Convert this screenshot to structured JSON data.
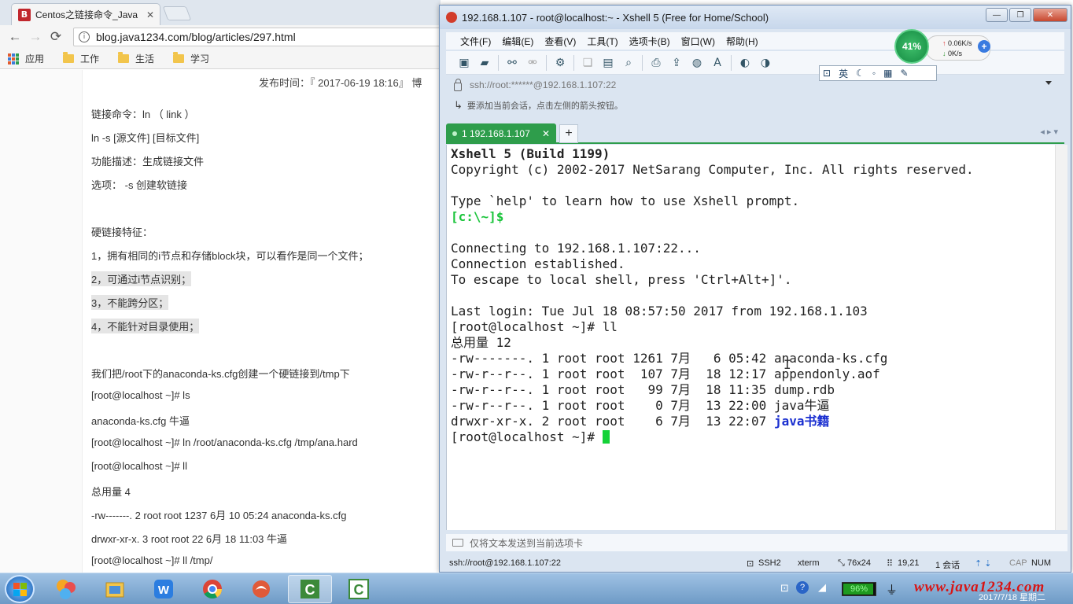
{
  "browser": {
    "tab_title": "Centos之链接命令_Java",
    "favicon_letter": "B",
    "url": "blog.java1234.com/blog/articles/297.html",
    "bookmarks": [
      "应用",
      "工作",
      "生活",
      "学习"
    ]
  },
  "article": {
    "publish_time": "发布时间：『 2017-06-19 18:16』  博",
    "lines": [
      "链接命令：ln （ link ）",
      "ln -s [源文件] [目标文件]",
      "功能描述：生成链接文件",
      "选项： -s 创建软链接",
      "硬链接特征：",
      "1，拥有相同的i节点和存储block块，可以看作是同一个文件；",
      "2，可通过i节点识别；",
      "3，不能跨分区；",
      "4，不能针对目录使用；",
      "我们把/root下的anaconda-ks.cfg创建一个硬链接到/tmp下",
      "[root@localhost ~]# ls",
      "anaconda-ks.cfg  牛逼",
      "[root@localhost ~]# ln /root/anaconda-ks.cfg /tmp/ana.hard",
      "[root@localhost ~]# ll",
      "总用量 4",
      "-rw-------. 2 root root 1237 6月  10 05:24 anaconda-ks.cfg",
      "drwxr-xr-x. 3 root root   22 6月  18 11:03 牛逼",
      "[root@localhost ~]# ll /tmp/"
    ]
  },
  "xshell": {
    "title": "192.168.1.107 - root@localhost:~ - Xshell 5 (Free for Home/School)",
    "menu": [
      "文件(F)",
      "编辑(E)",
      "查看(V)",
      "工具(T)",
      "选项卡(B)",
      "窗口(W)",
      "帮助(H)"
    ],
    "address": "ssh://root:******@192.168.1.107:22",
    "hint": "要添加当前会话，点击左侧的箭头按钮。",
    "tab_label": "1 192.168.1.107",
    "ime": [
      "英"
    ],
    "net": {
      "cpu": "41%",
      "up": "0.06K/s",
      "down": "0K/s"
    },
    "terminal": {
      "banner1": "Xshell 5 (Build 1199)",
      "banner2": "Copyright (c) 2002-2017 NetSarang Computer, Inc. All rights reserved.",
      "help": "Type `help' to learn how to use Xshell prompt.",
      "local_prompt": "[c:\\~]$",
      "connecting": "Connecting to 192.168.1.107:22...",
      "established": "Connection established.",
      "escape": "To escape to local shell, press 'Ctrl+Alt+]'.",
      "last_login": "Last login: Tue Jul 18 08:57:50 2017 from 192.168.1.103",
      "cmd_ll": "[root@localhost ~]# ll",
      "total": "总用量 12",
      "rows": [
        "-rw-------. 1 root root 1261 7月   6 05:42 anaconda-ks.cfg",
        "-rw-r--r--. 1 root root  107 7月  18 12:17 appendonly.aof",
        "-rw-r--r--. 1 root root   99 7月  18 11:35 dump.rdb",
        "-rw-r--r--. 1 root root    0 7月  13 22:00 java牛逼"
      ],
      "dir_row_prefix": "drwxr-xr-x. 2 root root    6 7月  13 22:07 ",
      "dir_row_name": "java书籍",
      "prompt": "[root@localhost ~]# "
    },
    "send_bar": "仅将文本发送到当前选项卡",
    "status": {
      "conn": "ssh://root@192.168.1.107:22",
      "proto": "SSH2",
      "term": "xterm",
      "size": "76x24",
      "pos": "19,21",
      "sessions": "1 会话",
      "caps": "CAP",
      "num": "NUM"
    }
  },
  "taskbar": {
    "battery": "96%",
    "battery_level": 0.96,
    "watermark": "www.java1234.com",
    "clock": "2017/7/18 星期二"
  }
}
